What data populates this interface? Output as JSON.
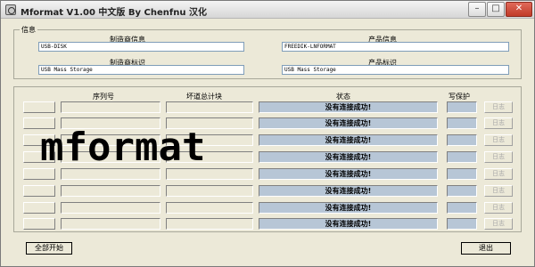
{
  "window": {
    "title": "Mformat V1.00 中文版 By Chenfnu 汉化",
    "controls": {
      "minimize": "–",
      "maximize": "□",
      "close": "✕"
    }
  },
  "info": {
    "group_label": "信息",
    "vendor_info_label": "制造商信息",
    "vendor_info_value": "USB-DISK",
    "product_info_label": "产品信息",
    "product_info_value": "FREEDIK-LNFORMAT",
    "vendor_id_label": "制造商标识",
    "vendor_id_value": "USB Mass Storage",
    "product_id_label": "产品标识",
    "product_id_value": "USB Mass Storage"
  },
  "ports": {
    "headers": {
      "serial": "序列号",
      "bad_blocks": "坏道总计块",
      "status": "状态",
      "write_protect": "写保护"
    },
    "rows": [
      {
        "status": "没有连接成功!",
        "log": "日志"
      },
      {
        "status": "没有连接成功!",
        "log": "日志"
      },
      {
        "status": "没有连接成功!",
        "log": "日志"
      },
      {
        "status": "没有连接成功!",
        "log": "日志"
      },
      {
        "status": "没有连接成功!",
        "log": "日志"
      },
      {
        "status": "没有连接成功!",
        "log": "日志"
      },
      {
        "status": "没有连接成功!",
        "log": "日志"
      },
      {
        "status": "没有连接成功!",
        "log": "日志"
      }
    ]
  },
  "footer": {
    "start_all": "全部开始",
    "exit": "退出"
  },
  "overlay": {
    "caption": "mformat"
  }
}
